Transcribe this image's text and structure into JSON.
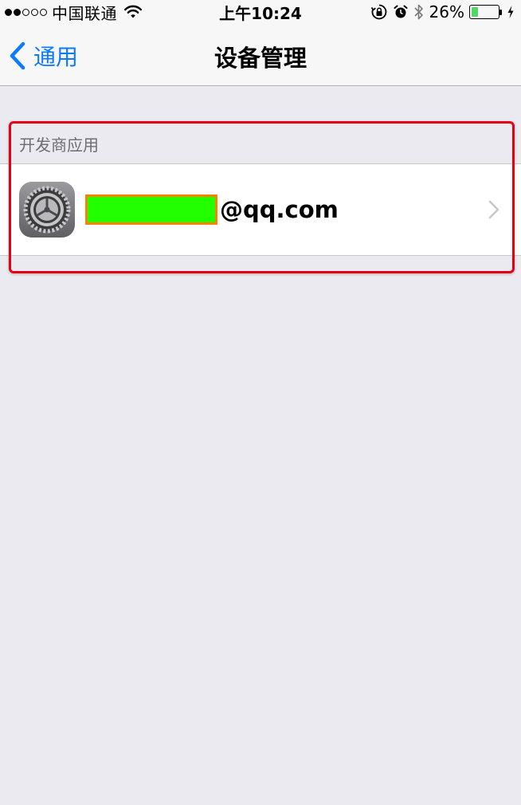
{
  "status_bar": {
    "signal_dots": {
      "filled": 2,
      "total": 5
    },
    "carrier": "中国联通",
    "time": "上午10:24",
    "battery_percent_text": "26%",
    "battery_level": 0.26,
    "icons": [
      "wifi-icon",
      "orientation-lock-icon",
      "alarm-icon",
      "bluetooth-icon",
      "battery-icon",
      "charging-bolt-icon"
    ]
  },
  "nav": {
    "back_label": "通用",
    "title": "设备管理"
  },
  "section": {
    "header": "开发商应用",
    "items": [
      {
        "icon": "settings-gear-icon",
        "label": "@qq.com",
        "redacted_prefix": true
      }
    ]
  },
  "colors": {
    "accent": "#0a7aff",
    "highlight_frame": "#e60012",
    "redaction_fill": "#22ff00",
    "redaction_border": "#ff7f00",
    "battery": "#4cd964"
  }
}
